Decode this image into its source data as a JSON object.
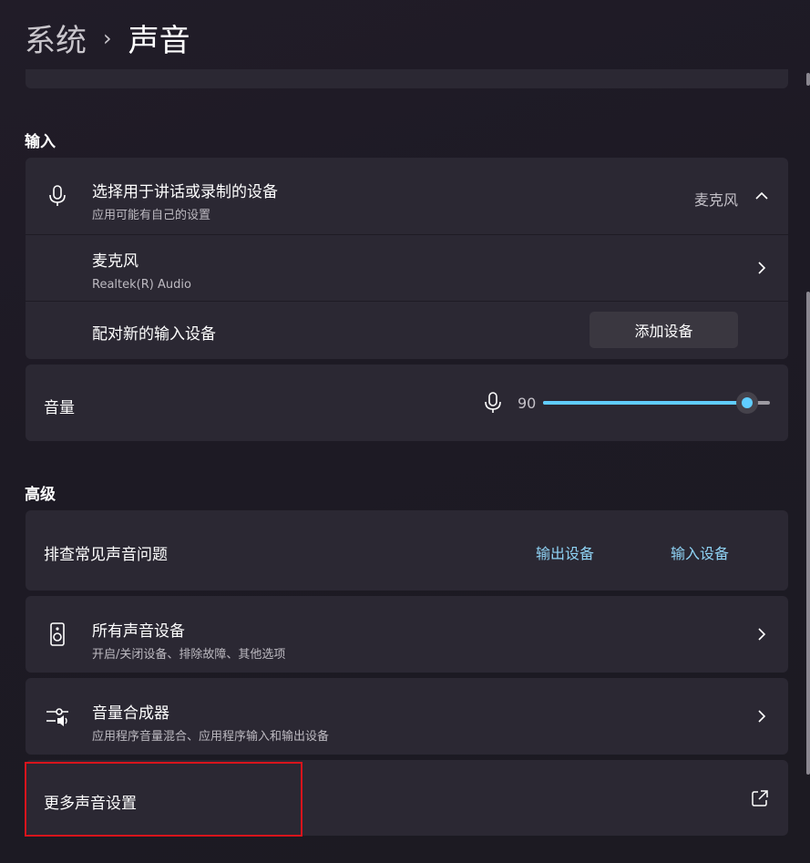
{
  "breadcrumb": {
    "parent": "系统",
    "separator": "›",
    "current": "声音"
  },
  "input_section": {
    "title": "输入",
    "device_chooser": {
      "title": "选择用于讲话或录制的设备",
      "subtitle": "应用可能有自己的设置",
      "selected_value": "麦克风",
      "icon": "microphone-icon",
      "expanded": true
    },
    "microphone_item": {
      "title": "麦克风",
      "subtitle": "Realtek(R) Audio"
    },
    "pair_new": {
      "title": "配对新的输入设备",
      "button_label": "添加设备"
    },
    "volume": {
      "title": "音量",
      "value_label": "90",
      "level": 0.9,
      "icon": "microphone-icon"
    }
  },
  "advanced_section": {
    "title": "高级",
    "troubleshoot": {
      "title": "排查常见声音问题",
      "link_output": "输出设备",
      "link_input": "输入设备"
    },
    "all_devices": {
      "title": "所有声音设备",
      "subtitle": "开启/关闭设备、排除故障、其他选项",
      "icon": "speaker-icon"
    },
    "mixer": {
      "title": "音量合成器",
      "subtitle": "应用程序音量混合、应用程序输入和输出设备",
      "icon": "volume-mixer-icon"
    },
    "more_settings": {
      "title": "更多声音设置",
      "icon": "open-external-icon"
    }
  },
  "colors": {
    "accent": "#60cdff",
    "link": "#8fd3f5",
    "card": "#2b2833",
    "highlight": "#d8141c"
  }
}
